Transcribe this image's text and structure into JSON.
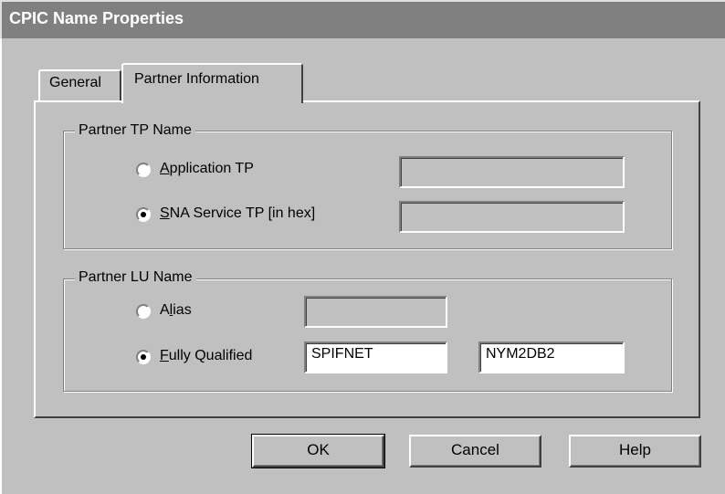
{
  "window": {
    "title": "CPIC Name Properties"
  },
  "tabs": [
    {
      "label": "General",
      "active": false
    },
    {
      "label": "Partner Information",
      "active": true
    }
  ],
  "partner_tp": {
    "legend": "Partner TP Name",
    "application_tp": {
      "mnemonic": "A",
      "label_rest": "pplication TP",
      "selected": false,
      "value": ""
    },
    "sna_service_tp": {
      "mnemonic": "S",
      "label_rest": "NA Service TP [in hex]",
      "selected": true,
      "value": ""
    }
  },
  "partner_lu": {
    "legend": "Partner LU Name",
    "alias": {
      "pre": "A",
      "mnemonic": "l",
      "label_rest": "ias",
      "selected": false,
      "value": ""
    },
    "fully_qualified": {
      "mnemonic": "F",
      "label_rest": "ully Qualified",
      "selected": true,
      "network": "SPIFNET",
      "lu": "NYM2DB2"
    }
  },
  "buttons": {
    "ok": "OK",
    "cancel": "Cancel",
    "help": "Help"
  }
}
